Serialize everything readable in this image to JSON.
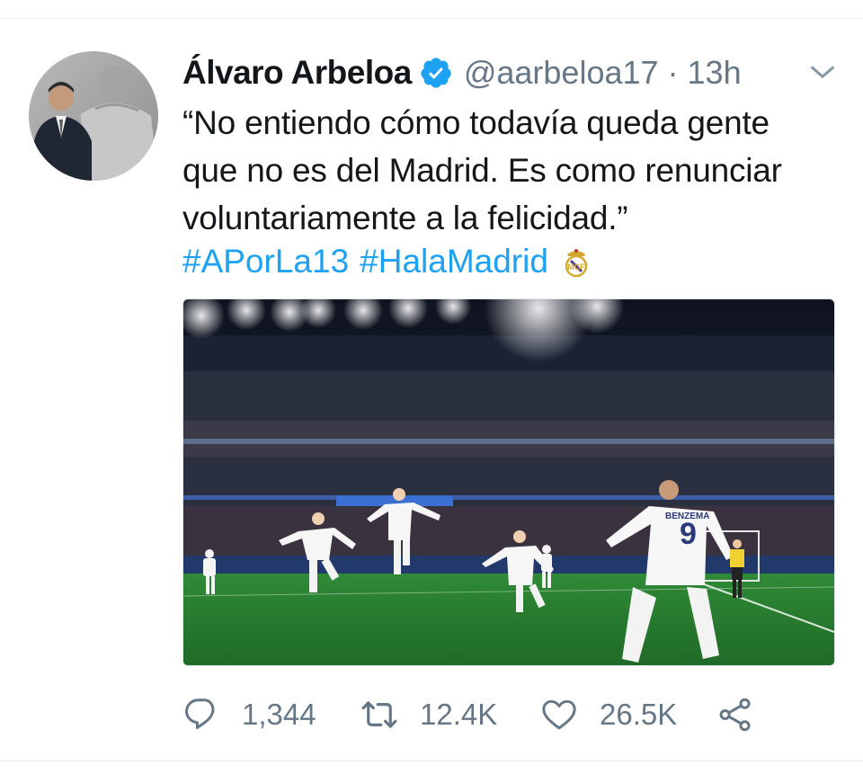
{
  "tweet": {
    "author": {
      "display_name": "Álvaro Arbeloa",
      "verified": true,
      "handle": "@aarbeloa17",
      "separator": "·",
      "time": "13h"
    },
    "text_lines": [
      "“No entiendo cómo todavía queda gente",
      "que no es del Madrid. Es como renunciar",
      "voluntariamente a la felicidad.”"
    ],
    "hashtags": [
      "#APorLa13",
      "#HalaMadrid"
    ],
    "emoji": "real-madrid-crest",
    "media": {
      "description_icon": "photo",
      "player_name": "BENZEMA",
      "player_number": "9"
    },
    "actions": {
      "replies": "1,344",
      "retweets": "12.4K",
      "likes": "26.5K"
    }
  },
  "colors": {
    "accent": "#1da1f2",
    "secondary_text": "#657786",
    "primary_text": "#14171a",
    "divider": "#e6ecf0"
  },
  "icons": [
    "chevron-down-icon",
    "verified-badge-icon",
    "reply-icon",
    "retweet-icon",
    "like-icon",
    "share-icon"
  ]
}
